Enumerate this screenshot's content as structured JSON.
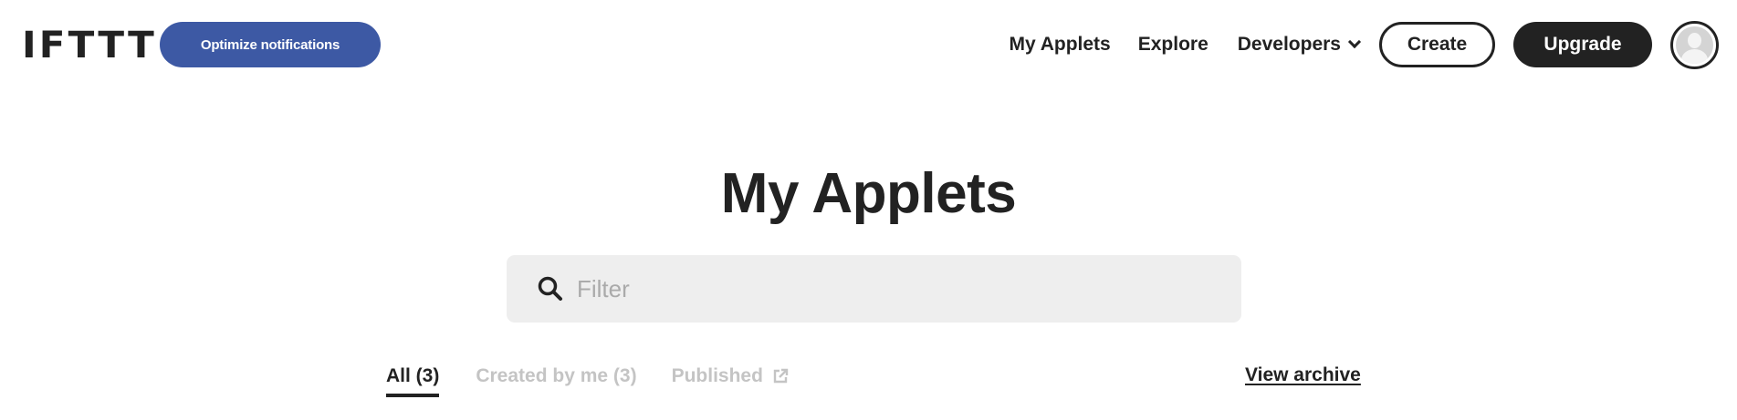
{
  "header": {
    "logo": "IFTTT",
    "optimize_button": "Optimize notifications",
    "nav": {
      "my_applets": "My Applets",
      "explore": "Explore",
      "developers": "Developers",
      "create": "Create",
      "upgrade": "Upgrade"
    },
    "icons": {
      "developers_dropdown": "chevron-down-icon",
      "avatar": "user-avatar-icon"
    }
  },
  "main": {
    "title": "My Applets",
    "search": {
      "placeholder": "Filter",
      "value": "",
      "icon": "search-icon"
    },
    "tabs": [
      {
        "label": "All (3)",
        "active": true
      },
      {
        "label": "Created by me (3)",
        "active": false
      },
      {
        "label": "Published",
        "active": false,
        "icon": "external-link-icon"
      }
    ],
    "view_archive": "View archive"
  },
  "colors": {
    "primary_text": "#222222",
    "optimize_button_bg": "#3d59a4",
    "search_bg": "#eeeeee",
    "inactive_tab": "#c4c4c4",
    "placeholder": "#aaaaaa"
  }
}
